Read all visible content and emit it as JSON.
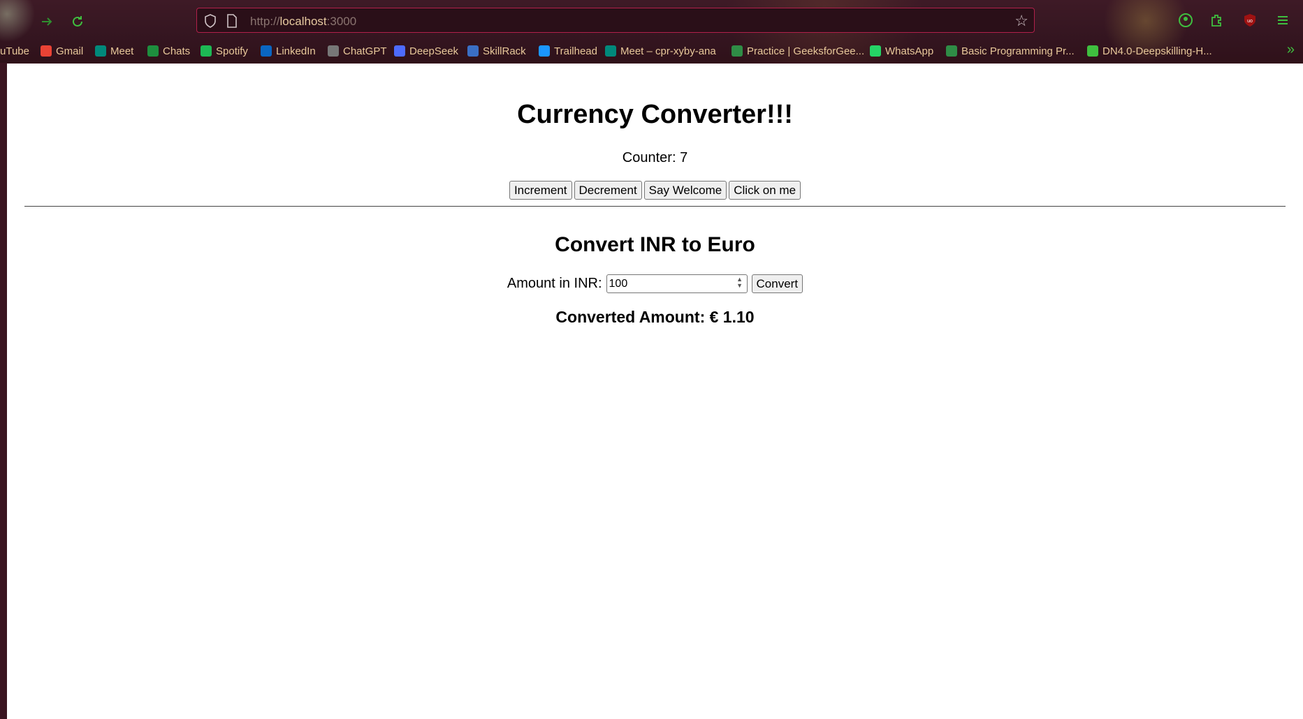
{
  "browser": {
    "url_protocol": "http://",
    "url_host": "localhost",
    "url_port": ":3000",
    "bookmarks": [
      {
        "label": "uTube",
        "icon": "youtube-icon",
        "color": "#e02020"
      },
      {
        "label": "Gmail",
        "icon": "gmail-icon",
        "color": "#ea4335"
      },
      {
        "label": "Meet",
        "icon": "meet-icon",
        "color": "#00897b"
      },
      {
        "label": "Chats",
        "icon": "chats-icon",
        "color": "#1e8e3e"
      },
      {
        "label": "Spotify",
        "icon": "spotify-icon",
        "color": "#1db954"
      },
      {
        "label": "LinkedIn",
        "icon": "linkedin-icon",
        "color": "#0a66c2"
      },
      {
        "label": "ChatGPT",
        "icon": "chatgpt-icon",
        "color": "#777777"
      },
      {
        "label": "DeepSeek",
        "icon": "deepseek-icon",
        "color": "#4d6bfe"
      },
      {
        "label": "SkillRack",
        "icon": "skillrack-icon",
        "color": "#3a6fc4"
      },
      {
        "label": "Trailhead",
        "icon": "trailhead-icon",
        "color": "#1b96ff"
      },
      {
        "label": "Meet – cpr-xyby-ana",
        "icon": "meet-icon",
        "color": "#00897b"
      },
      {
        "label": "Practice | GeeksforGee...",
        "icon": "geeksforgeeks-icon",
        "color": "#2f8d46"
      },
      {
        "label": "WhatsApp",
        "icon": "whatsapp-icon",
        "color": "#25d366"
      },
      {
        "label": "Basic Programming Pr...",
        "icon": "geeksforgeeks-icon",
        "color": "#2f8d46"
      },
      {
        "label": "DN4.0-Deepskilling-H...",
        "icon": "globe-icon",
        "color": "#3fbf3f"
      }
    ]
  },
  "app": {
    "title": "Currency Converter!!!",
    "counter_label": "Counter: 7",
    "buttons": {
      "increment": "Increment",
      "decrement": "Decrement",
      "welcome": "Say Welcome",
      "click": "Click on me"
    },
    "convert_title": "Convert INR to Euro",
    "amount_label": "Amount in INR:",
    "amount_value": "100",
    "convert_button": "Convert",
    "converted_text": "Converted Amount: € 1.10"
  }
}
